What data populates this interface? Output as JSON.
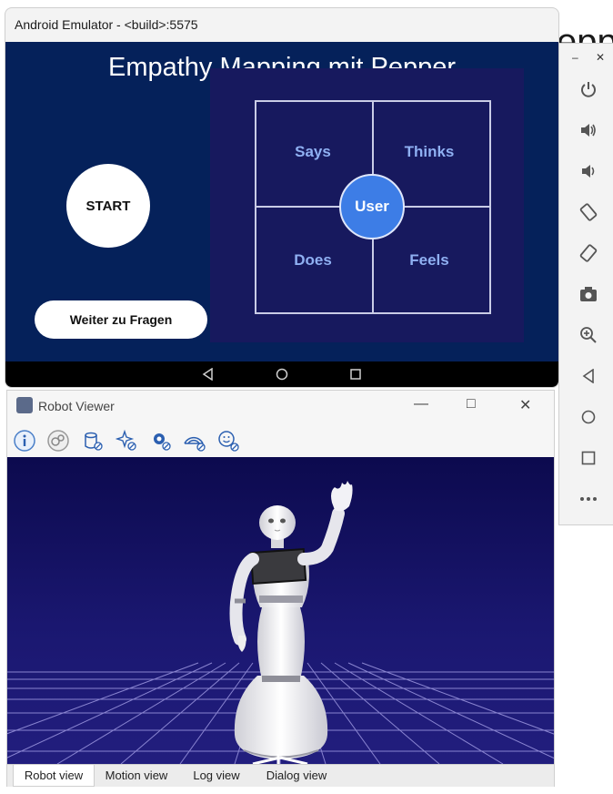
{
  "background_fragment": "epp",
  "emulator": {
    "window_title": "Android Emulator - <build>:5575",
    "app": {
      "title": "Empathy Mapping mit Pepper",
      "quadrants": [
        "Says",
        "Thinks",
        "Does",
        "Feels"
      ],
      "center_label": "User",
      "start_label": "START",
      "continue_label": "Weiter zu Fragen"
    },
    "nav": [
      "back-icon",
      "home-icon",
      "recents-icon"
    ]
  },
  "sidebar": {
    "controls": [
      "minimize",
      "close"
    ],
    "icons": [
      "power-icon",
      "volume-up-icon",
      "volume-down-icon",
      "rotate-left-icon",
      "rotate-right-icon",
      "camera-icon",
      "zoom-icon",
      "back-icon",
      "home-icon",
      "overview-icon",
      "more-icon"
    ]
  },
  "robot_viewer": {
    "window_title": "Robot Viewer",
    "toolbar": [
      "info-icon",
      "joints-icon",
      "cylinder-icon",
      "sparkle-icon",
      "gear-icon",
      "sonar-icon",
      "face-icon"
    ],
    "tabs": [
      "Robot view",
      "Motion view",
      "Log view",
      "Dialog view"
    ],
    "active_tab": "Robot view",
    "colors": {
      "viewport": "#12105a",
      "grid": "#9c97e0"
    }
  }
}
